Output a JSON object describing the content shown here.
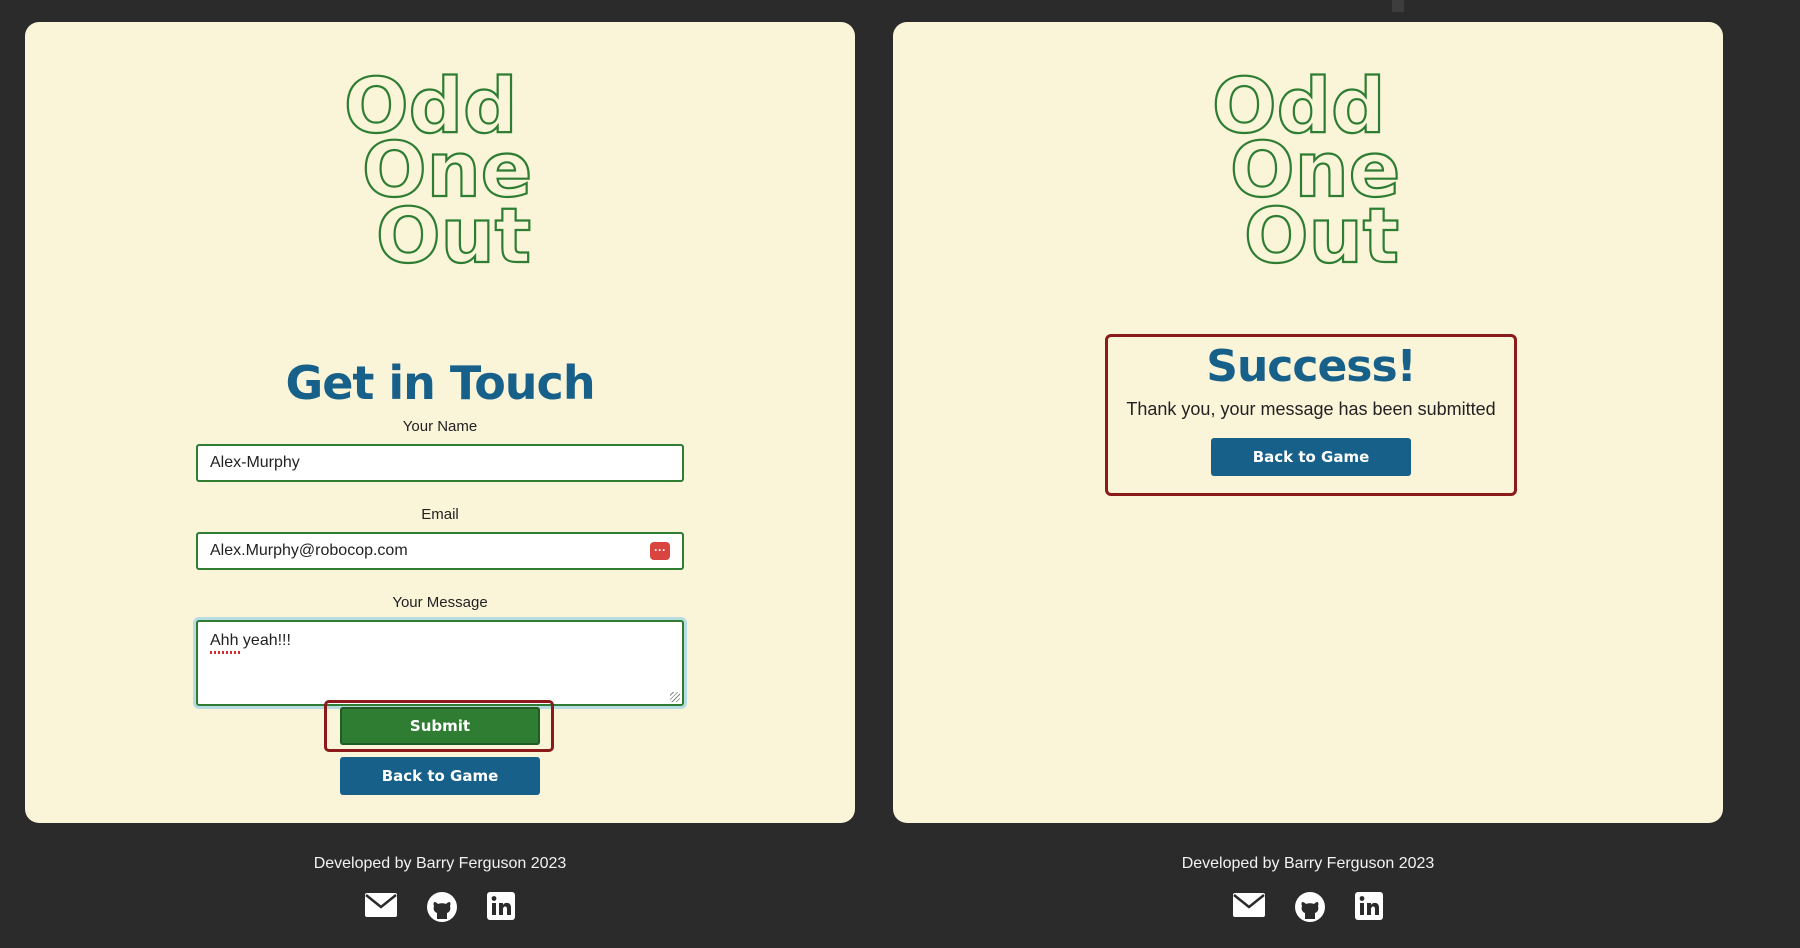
{
  "logo": {
    "line1": "Odd",
    "line2": "One",
    "line3": "Out"
  },
  "contact_form": {
    "title": "Get in Touch",
    "name_label": "Your Name",
    "name_value": "Alex-Murphy",
    "email_label": "Email",
    "email_value": "Alex.Murphy@robocop.com",
    "message_label": "Your Message",
    "message_value": "Ahh yeah!!!",
    "submit_label": "Submit",
    "back_label": "Back to Game"
  },
  "success": {
    "title": "Success!",
    "message": "Thank you, your message has been submitted",
    "back_label": "Back to Game"
  },
  "footer": {
    "credit": "Developed by Barry Ferguson 2023",
    "icons": [
      "envelope-icon",
      "github-icon",
      "linkedin-icon"
    ]
  },
  "colors": {
    "background": "#2b2b2b",
    "panel": "#faf4d9",
    "accent_blue": "#17608a",
    "accent_green": "#2e7d32",
    "focus_red": "#8b1a1a"
  }
}
